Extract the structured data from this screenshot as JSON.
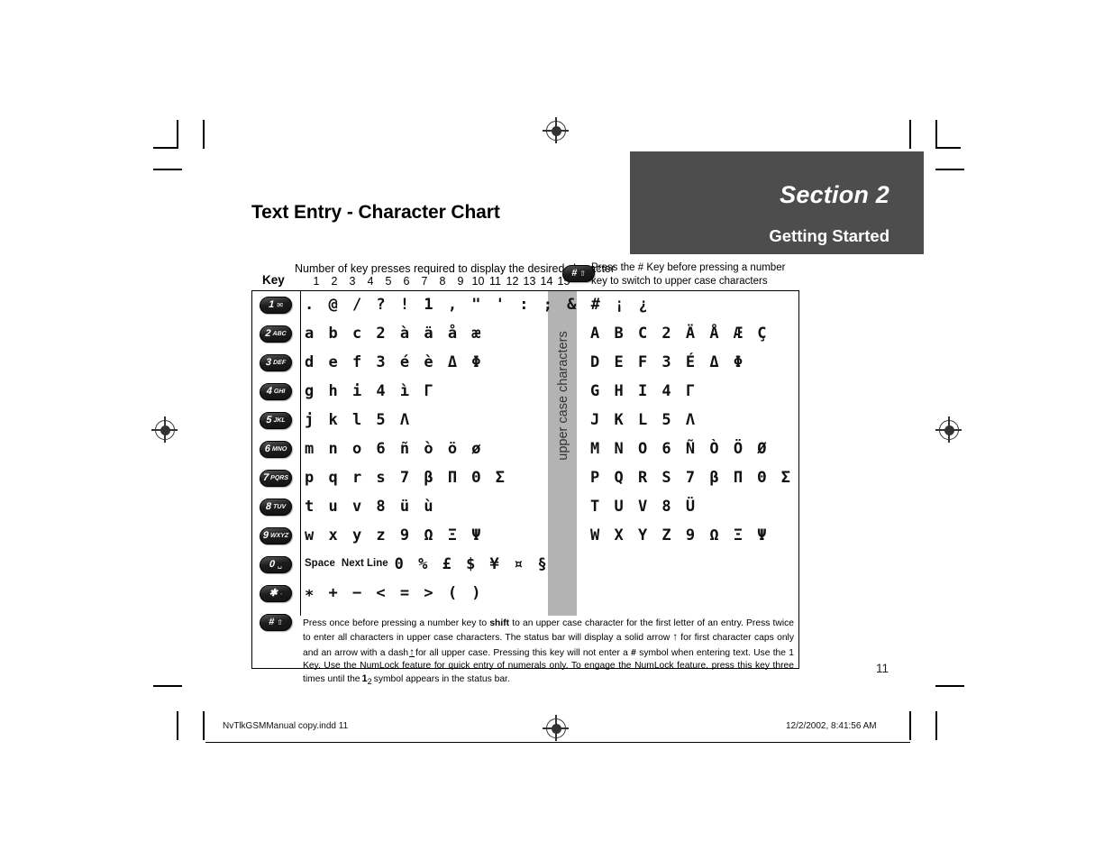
{
  "page": {
    "title": "Text Entry - Character Chart",
    "number": "11",
    "section_band_color": "#4d4d4d",
    "upper_band_color": "#b3b3b3"
  },
  "section": {
    "title": "Section 2",
    "subtitle": "Getting Started"
  },
  "chart_header": {
    "key_label": "Key",
    "presses_caption": "Number of key presses required to display the desired character",
    "press_numbers": [
      "1",
      "2",
      "3",
      "4",
      "5",
      "6",
      "7",
      "8",
      "9",
      "10",
      "11",
      "12",
      "13",
      "14",
      "15"
    ],
    "hash_note_line1": "Press the # Key before pressing a number",
    "hash_note_line2": "key to switch to upper case characters",
    "hash_note_key": {
      "num": "#",
      "glyph": "⇧"
    }
  },
  "upper_band_label": "upper case characters",
  "rows": [
    {
      "key": {
        "num": "1",
        "sub": "",
        "glyph": "✉"
      },
      "lower": ". @ / ? ! 1 , \" ' : ; & # ¡ ¿",
      "upper": ""
    },
    {
      "key": {
        "num": "2",
        "sub": "ABC",
        "glyph": ""
      },
      "lower": "a b c 2 à ä å æ",
      "upper": "A B C 2 Ä Å Æ Ç"
    },
    {
      "key": {
        "num": "3",
        "sub": "DEF",
        "glyph": ""
      },
      "lower": "d e f 3 é è Δ Φ",
      "upper": "D E F 3 É Δ Φ"
    },
    {
      "key": {
        "num": "4",
        "sub": "GHI",
        "glyph": ""
      },
      "lower": "g h i 4 ì Γ",
      "upper": "G H I 4 Γ"
    },
    {
      "key": {
        "num": "5",
        "sub": "JKL",
        "glyph": ""
      },
      "lower": "j k l 5 Λ",
      "upper": "J K L 5 Λ"
    },
    {
      "key": {
        "num": "6",
        "sub": "MNO",
        "glyph": ""
      },
      "lower": "m n o 6 ñ ò ö ø",
      "upper": "M N O 6 Ñ Ò Ö Ø"
    },
    {
      "key": {
        "num": "7",
        "sub": "PQRS",
        "glyph": ""
      },
      "lower": "p q r s 7 β Π Θ Σ",
      "upper": "P Q R S 7 β Π Θ Σ"
    },
    {
      "key": {
        "num": "8",
        "sub": "TUV",
        "glyph": ""
      },
      "lower": "t u v 8 ü ù",
      "upper": "T U V 8 Ü"
    },
    {
      "key": {
        "num": "9",
        "sub": "WXYZ",
        "glyph": ""
      },
      "lower": "w x y z 9 Ω Ξ Ψ",
      "upper": "W X Y Z 9 Ω Ξ Ψ"
    },
    {
      "key": {
        "num": "0",
        "sub": "",
        "glyph": "␣"
      },
      "lower_words": [
        "Space",
        "Next Line"
      ],
      "lower": "0 % £ $ ¥ ¤ §",
      "upper": ""
    },
    {
      "key": {
        "num": "✱",
        "sub": "",
        "glyph": "·"
      },
      "lower": "∗ + − < = > ( )",
      "upper": ""
    },
    {
      "key": {
        "num": "#",
        "sub": "",
        "glyph": "⇧"
      },
      "lower": "",
      "upper": ""
    }
  ],
  "footnote": {
    "part1": "Press once before pressing a number key to ",
    "bold1": "shift",
    "part2": " to an upper case character for the first letter of an entry.  Press twice to enter all characters in upper case characters.  The status bar will display a solid arrow",
    "arrow_solid": "↑",
    "part3": "for first character caps only and an arrow with a dash",
    "arrow_dash": "↑",
    "part4": "for all upper case.  Pressing this key will not enter a ",
    "bold2": "#",
    "part5": " symbol when entering text.  Use the 1 Key.  Use the NumLock feature for quick entry of numerals only.  To engage the NumLock feature, press this key three times until the",
    "numlock_top": "1",
    "numlock_bottom": "2",
    "part6": "symbol appears in the status bar."
  },
  "print_footer": {
    "filename": "NvTlkGSMManual copy.indd   11",
    "timestamp": "12/2/2002, 8:41:56 AM"
  }
}
